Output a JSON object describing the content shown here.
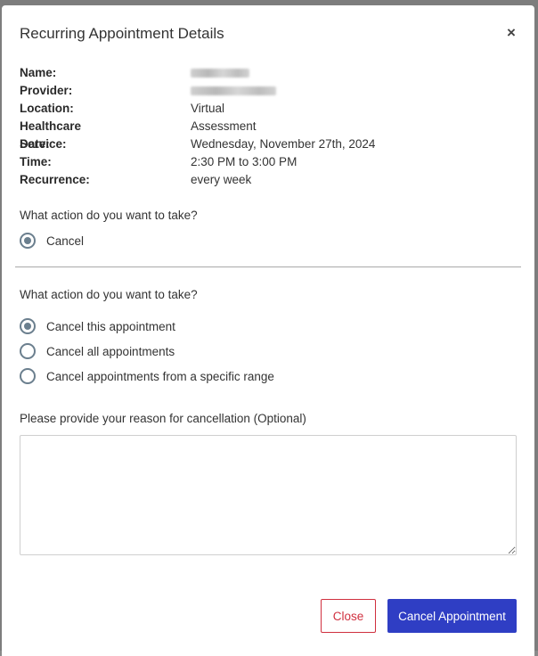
{
  "dialog": {
    "title": "Recurring Appointment Details",
    "close_symbol": "×"
  },
  "details": [
    {
      "key": "Name:",
      "value": ""
    },
    {
      "key": "Provider:",
      "value": ""
    },
    {
      "key": "Location:",
      "value": "Virtual"
    },
    {
      "key": "Healthcare Service:",
      "value": "Assessment"
    },
    {
      "key": "Date:",
      "value": "Wednesday, November 27th, 2024"
    },
    {
      "key": "Time:",
      "value": "2:30 PM to 3:00 PM"
    },
    {
      "key": "Recurrence:",
      "value": "every week"
    }
  ],
  "action_section": {
    "question": "What action do you want to take?",
    "options": [
      {
        "label": "Cancel",
        "checked": true
      }
    ]
  },
  "scope_section": {
    "question": "What action do you want to take?",
    "options": [
      {
        "label": "Cancel this appointment",
        "checked": true
      },
      {
        "label": "Cancel all appointments",
        "checked": false
      },
      {
        "label": "Cancel appointments from a specific range",
        "checked": false
      }
    ]
  },
  "reason": {
    "label": "Please provide your reason for cancellation (Optional)",
    "value": ""
  },
  "footer": {
    "close_label": "Close",
    "cancel_appointment_label": "Cancel Appointment"
  },
  "colors": {
    "primary_button": "#2f3ec4",
    "danger_outline": "#d0303f",
    "radio": "#6b7f8e"
  }
}
